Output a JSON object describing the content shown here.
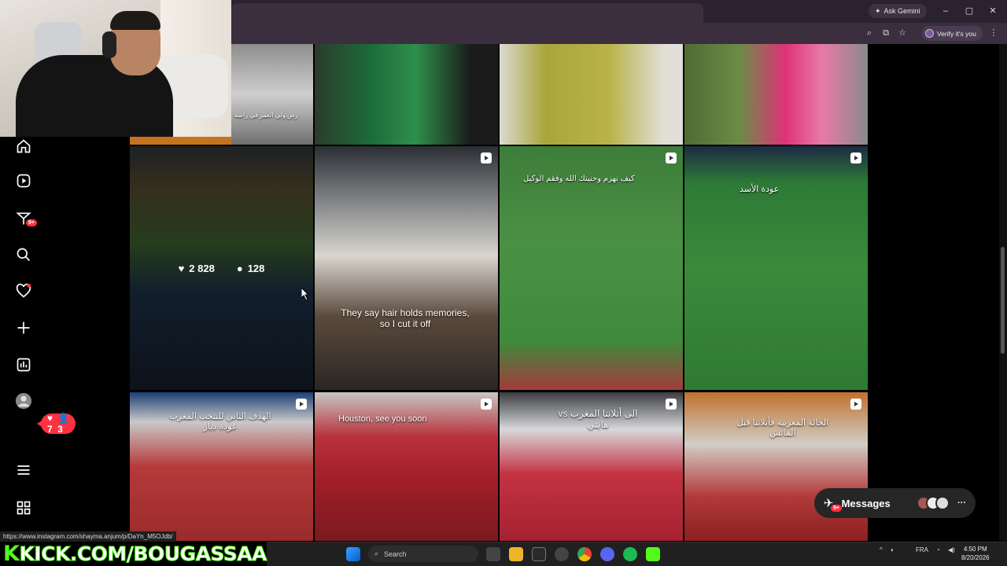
{
  "browser": {
    "gemini_label": "Ask Gemini",
    "verify_label": "Verify it's you"
  },
  "stream": {
    "overlay_text": "KICK.COM/BOUGASSAA"
  },
  "sidebar": {
    "icons": [
      "home-icon",
      "reels-icon",
      "messenger-icon",
      "search-icon",
      "heart-icon",
      "create-icon",
      "dashboard-icon",
      "profile-avatar",
      "menu-icon",
      "more-icon"
    ],
    "messenger_badge": "9+",
    "notif_likes": "7",
    "notif_follows": "3"
  },
  "grid": {
    "tiles": [
      {
        "caption": "رض ولي العمر في راسه",
        "reel": false
      },
      {
        "caption": "",
        "reel": false
      },
      {
        "caption": "",
        "reel": false
      },
      {
        "caption": "",
        "reel": false
      },
      {
        "caption": "",
        "reel": false,
        "likes": "2 828",
        "comments": "128"
      },
      {
        "caption": "They say hair holds memories, so I cut it off",
        "reel": true
      },
      {
        "caption": "كيف نهزم وحنيتك الله وفقم الوكيل",
        "reel": true
      },
      {
        "caption": "عودة الأسد",
        "reel": true
      },
      {
        "caption": "الهدف الثاني للنتخب المغرب عودة دياز",
        "reel": true
      },
      {
        "caption": "Houston, see you soon",
        "reel": true
      },
      {
        "caption": "الى أتلانتا المغرب vs هايتي",
        "reel": true
      },
      {
        "caption": "الحالة المغربية فأتلانتا قبل الماتش",
        "reel": true
      }
    ]
  },
  "messages": {
    "label": "Messages",
    "badge": "9+"
  },
  "status_url": "https://www.instagram.com/shayma.anjum/p/DaYn_M5OJdb/",
  "taskbar": {
    "search_placeholder": "Search",
    "lang": "FRA",
    "time": "4:50 PM",
    "date": "8/20/2026"
  }
}
